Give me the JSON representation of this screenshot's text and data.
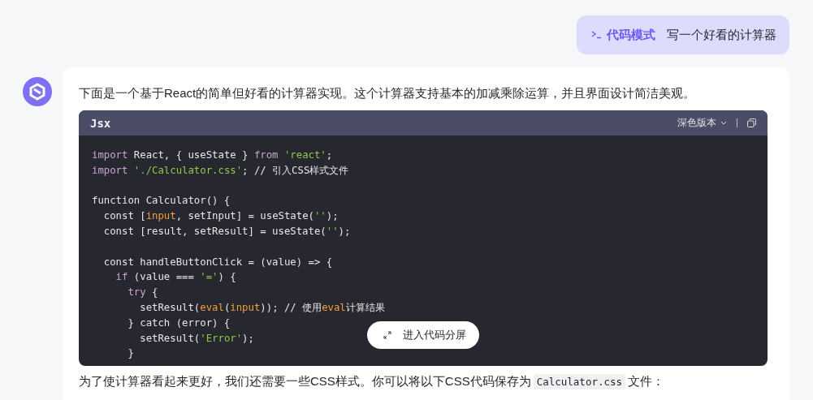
{
  "user_message": {
    "mode_label": "代码模式",
    "text": "写一个好看的计算器"
  },
  "answer": {
    "intro": "下面是一个基于React的简单但好看的计算器实现。这个计算器支持基本的加减乘除运算，并且界面设计简洁美观。",
    "code_block": {
      "language": "Jsx",
      "theme_label": "深色版本",
      "split_button": "进入代码分屏",
      "lines": [
        {
          "gap_before": false,
          "tokens": [
            {
              "text": "import",
              "kind": "keyword"
            },
            {
              "text": " React, { useState } ",
              "kind": "plain"
            },
            {
              "text": "from",
              "kind": "keyword"
            },
            {
              "text": " 'react'",
              "kind": "string"
            },
            {
              "text": ";",
              "kind": "plain"
            }
          ]
        },
        {
          "gap_before": false,
          "tokens": [
            {
              "text": "import",
              "kind": "keyword"
            },
            {
              "text": " './Calculator.css'",
              "kind": "string"
            },
            {
              "text": "; // 引入CSS样式文件",
              "kind": "plain"
            }
          ]
        },
        {
          "gap_before": true,
          "tokens": [
            {
              "text": "function Calculator() {",
              "kind": "plain"
            }
          ]
        },
        {
          "gap_before": false,
          "tokens": [
            {
              "text": "  const [",
              "kind": "plain"
            },
            {
              "text": "input",
              "kind": "variable"
            },
            {
              "text": ", setInput] = useState(",
              "kind": "plain"
            },
            {
              "text": "''",
              "kind": "string"
            },
            {
              "text": ");",
              "kind": "plain"
            }
          ]
        },
        {
          "gap_before": false,
          "tokens": [
            {
              "text": "  const [result, setResult] = useState(",
              "kind": "plain"
            },
            {
              "text": "''",
              "kind": "string"
            },
            {
              "text": ");",
              "kind": "plain"
            }
          ]
        },
        {
          "gap_before": true,
          "tokens": [
            {
              "text": "  const handleButtonClick = (value) => {",
              "kind": "plain"
            }
          ]
        },
        {
          "gap_before": false,
          "tokens": [
            {
              "text": "    if",
              "kind": "keyword"
            },
            {
              "text": " (value === ",
              "kind": "plain"
            },
            {
              "text": "'='",
              "kind": "string"
            },
            {
              "text": ") {",
              "kind": "plain"
            }
          ]
        },
        {
          "gap_before": false,
          "tokens": [
            {
              "text": "      try",
              "kind": "keyword"
            },
            {
              "text": " {",
              "kind": "plain"
            }
          ]
        },
        {
          "gap_before": false,
          "tokens": [
            {
              "text": "        setResult(",
              "kind": "plain"
            },
            {
              "text": "eval",
              "kind": "variable"
            },
            {
              "text": "(",
              "kind": "plain"
            },
            {
              "text": "input",
              "kind": "variable"
            },
            {
              "text": ")); // 使用",
              "kind": "plain"
            },
            {
              "text": "eval",
              "kind": "variable"
            },
            {
              "text": "计算结果",
              "kind": "plain"
            }
          ]
        },
        {
          "gap_before": false,
          "tokens": [
            {
              "text": "      } catch (error) {",
              "kind": "plain"
            }
          ]
        },
        {
          "gap_before": false,
          "tokens": [
            {
              "text": "        setResult(",
              "kind": "plain"
            },
            {
              "text": "'Error'",
              "kind": "string"
            },
            {
              "text": ");",
              "kind": "plain"
            }
          ]
        },
        {
          "gap_before": false,
          "tokens": [
            {
              "text": "      }",
              "kind": "plain"
            }
          ]
        }
      ]
    },
    "outro": {
      "before": "为了使计算器看起来更好，我们还需要一些CSS样式。你可以将以下CSS代码保存为",
      "code": "Calculator.css",
      "after": "文件："
    }
  }
}
